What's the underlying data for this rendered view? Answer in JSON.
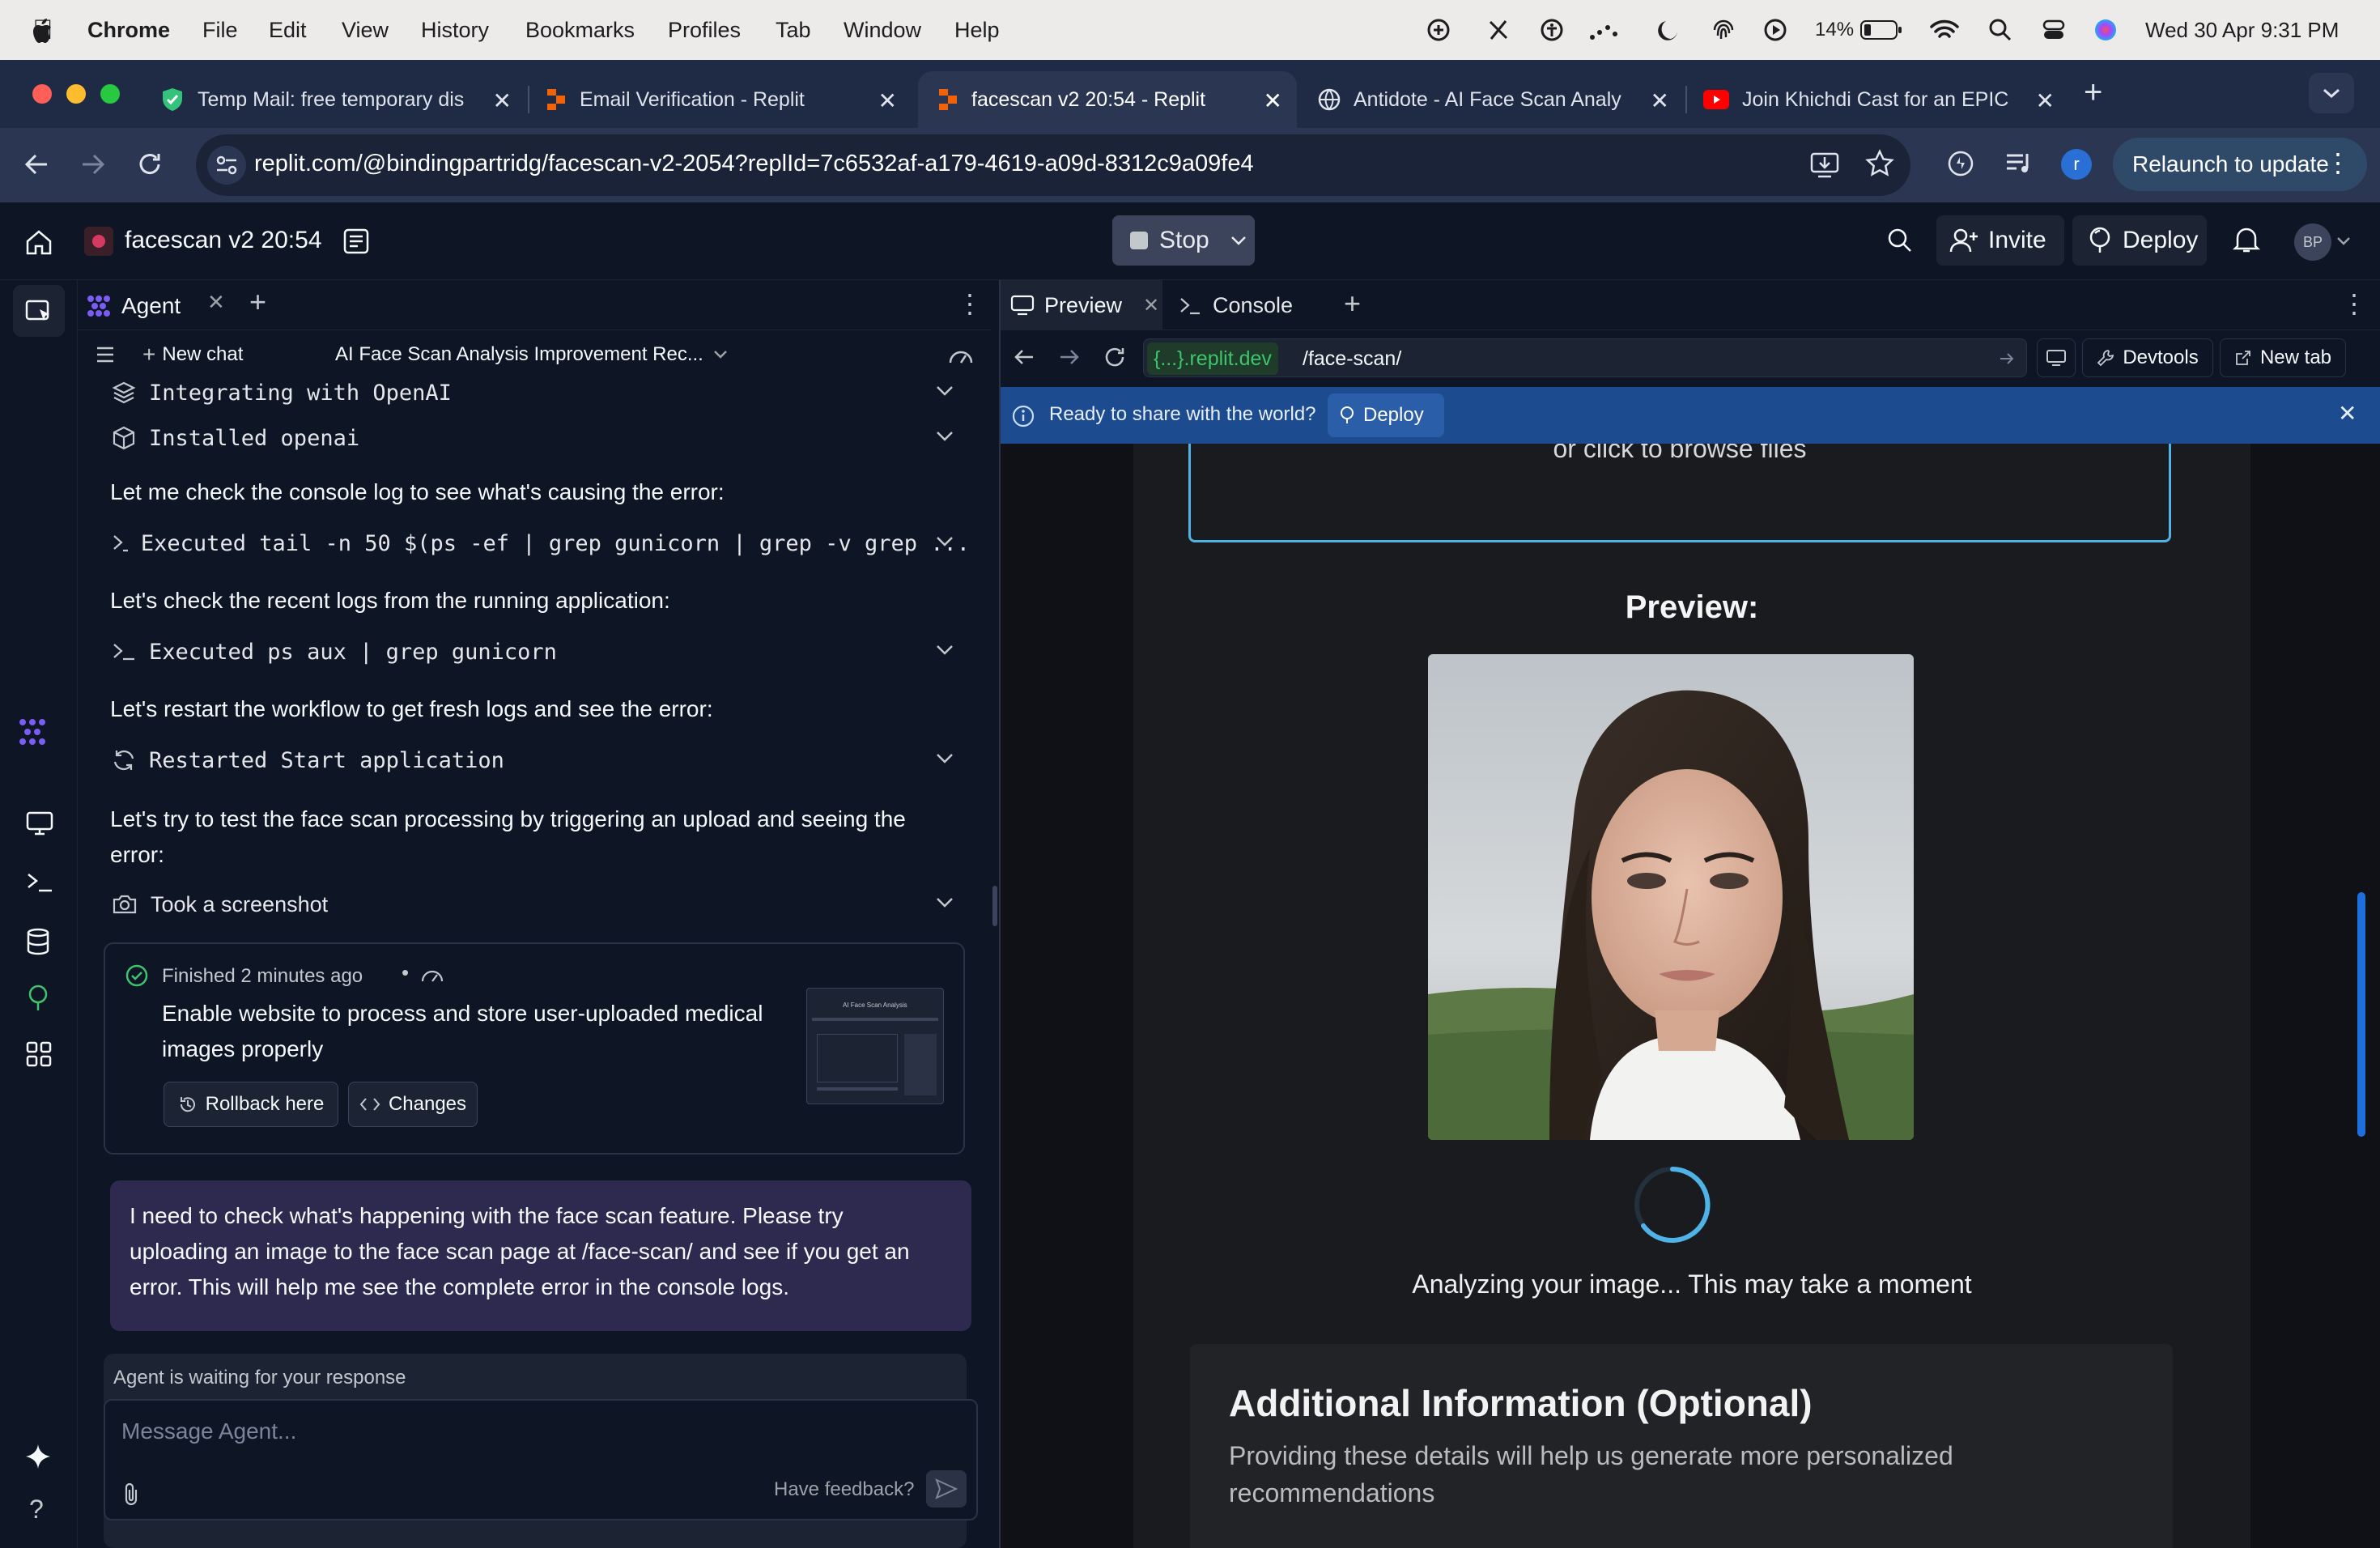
{
  "menubar": {
    "app": "Chrome",
    "items": [
      "File",
      "Edit",
      "View",
      "History",
      "Bookmarks",
      "Profiles",
      "Tab",
      "Window",
      "Help"
    ],
    "battery": "14%",
    "datetime": "Wed 30 Apr  9:31 PM"
  },
  "tabs": [
    {
      "title": "Temp Mail: free temporary dis"
    },
    {
      "title": "Email Verification - Replit"
    },
    {
      "title": "facescan v2 20:54 - Replit"
    },
    {
      "title": "Antidote - AI Face Scan Analy"
    },
    {
      "title": "Join Khichdi Cast for an EPIC"
    }
  ],
  "address": {
    "url": "replit.com/@bindingpartridg/facescan-v2-2054?replId=7c6532af-a179-4619-a09d-8312c9a09fe4",
    "profile_initial": "r",
    "relaunch_label": "Relaunch to update"
  },
  "header": {
    "project": "facescan v2 20:54",
    "stop_label": "Stop",
    "invite_label": "Invite",
    "deploy_label": "Deploy",
    "avatar": "BP"
  },
  "agent": {
    "tab_label": "Agent",
    "new_chat": "New chat",
    "chat_title": "AI Face Scan Analysis Improvement Rec...",
    "steps": [
      {
        "text": "Integrating with OpenAI"
      },
      {
        "text": "Installed openai"
      }
    ],
    "msg1": "Let me check the console log to see what's causing the error:",
    "exec1": "Executed tail -n 50 $(ps -ef | grep gunicorn | grep -v grep ...",
    "msg2": "Let's check the recent logs from the running application:",
    "exec2": "Executed ps aux | grep gunicorn",
    "msg3": "Let's restart the workflow to get fresh logs and see the error:",
    "exec3": "Restarted Start application",
    "msg4_line1": "Let's try to test the face scan processing by triggering an upload and seeing the",
    "msg4_line2": "error:",
    "screenshot_step": "Took a screenshot",
    "checkpoint": {
      "status": "Finished 2 minutes ago",
      "title_line1": "Enable website to process and store user-uploaded medical",
      "title_line2": "images properly",
      "rollback": "Rollback here",
      "changes": "Changes",
      "thumb_title": "AI Face Scan Analysis"
    },
    "user_msg_line1": "I need to check what's happening with the face scan feature. Please try",
    "user_msg_line2": "uploading an image to the face scan page at /face-scan/ and see if you get an",
    "user_msg_line3": "error. This will help me see the complete error in the console logs.",
    "waiting": "Agent is waiting for your response",
    "input_placeholder": "Message Agent...",
    "feedback": "Have feedback?"
  },
  "preview": {
    "tab_preview": "Preview",
    "tab_console": "Console",
    "domain": "{...}.replit.dev",
    "path": "/face-scan/",
    "devtools": "Devtools",
    "new_tab": "New tab",
    "banner_text": "Ready to share with the world?",
    "banner_deploy": "Deploy",
    "browse_text": "or click to browse files",
    "preview_heading": "Preview:",
    "analyzing": "Analyzing your image... This may take a moment",
    "additional_title": "Additional Information (Optional)",
    "additional_line1": "Providing these details will help us generate more personalized",
    "additional_line2": "recommendations"
  },
  "colors": {
    "bg": "#0e1525",
    "accent_blue": "#0079f2",
    "spinner": "#4fb3e8",
    "user_bubble": "#2e2a4f",
    "green_check": "#3ec46d"
  }
}
